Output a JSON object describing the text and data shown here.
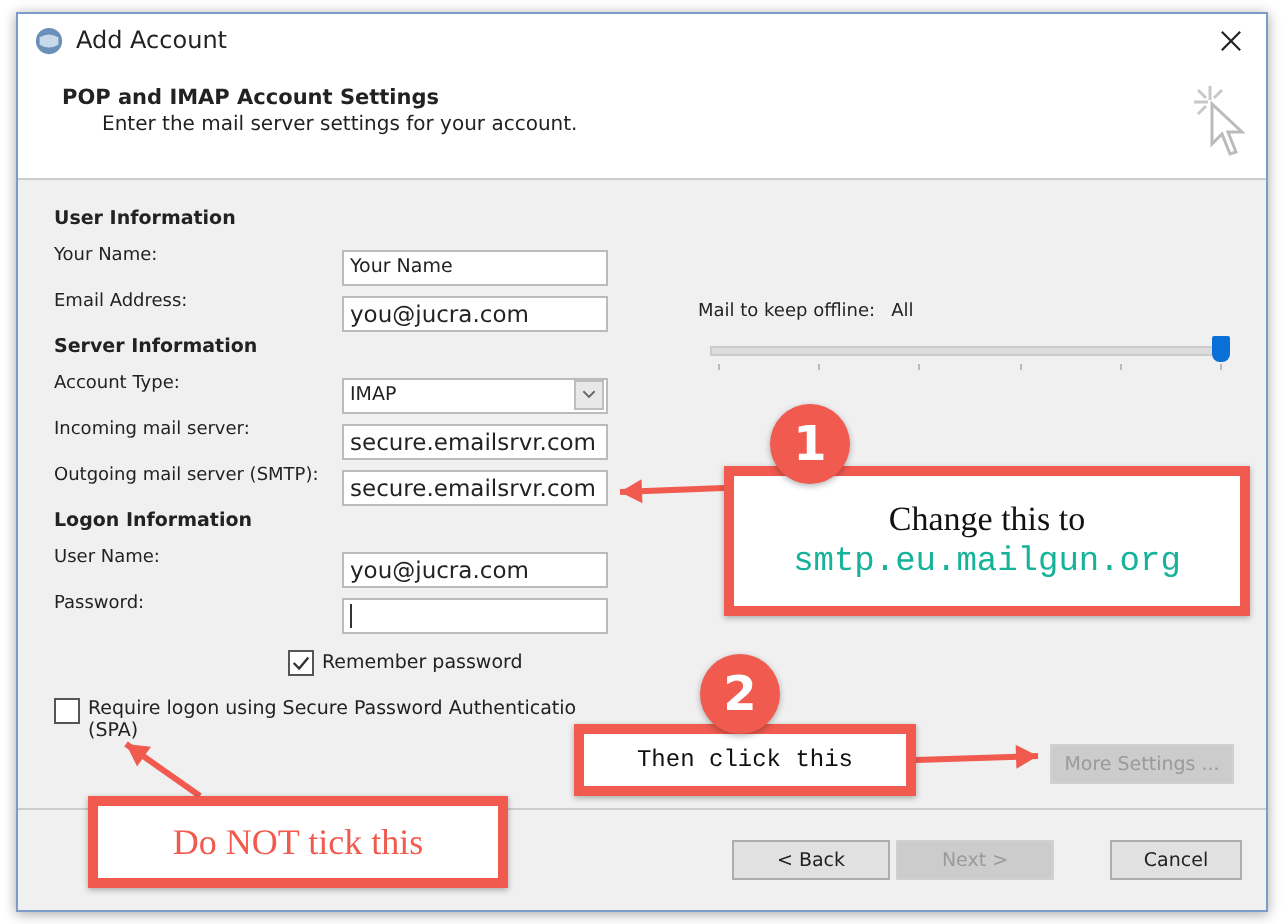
{
  "window": {
    "title": "Add Account"
  },
  "header": {
    "title": "POP and IMAP Account Settings",
    "subtitle": "Enter the mail server settings for your account."
  },
  "sections": [
    {
      "heading": "User Information",
      "fields": [
        {
          "label": "Your Name:",
          "kind": "text",
          "value": "Your Name"
        },
        {
          "label": "Email Address:",
          "kind": "text",
          "value": "you@jucra.com"
        }
      ]
    },
    {
      "heading": "Server Information",
      "fields": [
        {
          "label": "Account Type:",
          "kind": "select",
          "value": "IMAP"
        },
        {
          "label": "Incoming mail server:",
          "kind": "text",
          "value": "secure.emailsrvr.com"
        },
        {
          "label": "Outgoing mail server (SMTP):",
          "kind": "text",
          "value": "secure.emailsrvr.com"
        }
      ]
    },
    {
      "heading": "Logon Information",
      "fields": [
        {
          "label": "User Name:",
          "kind": "text",
          "value": "you@jucra.com"
        },
        {
          "label": "Password:",
          "kind": "password"
        }
      ]
    }
  ],
  "remember_password": {
    "label": "Remember password",
    "checked": true
  },
  "spa": {
    "label": "Require logon using Secure Password Authenticatio",
    "label_2": "(SPA)",
    "checked": false
  },
  "offline": {
    "label": "Mail to keep offline:",
    "value": "All",
    "level": 1
  },
  "more_settings": {
    "label": "More Settings ...",
    "disabled": true
  },
  "buttons": [
    {
      "label": "< Back",
      "disabled": false
    },
    {
      "label": "Next >",
      "disabled": true
    },
    {
      "label": "Cancel",
      "disabled": false
    }
  ],
  "callouts": [
    {
      "number": "1",
      "lines": [
        {
          "kind": "serif",
          "text": "Change this to"
        },
        {
          "kind": "mono",
          "text": "smtp.eu.mailgun.org"
        }
      ]
    },
    {
      "number": "2",
      "lines": [
        {
          "kind": "mono",
          "text": "Then click this"
        }
      ]
    },
    {
      "lines": [
        {
          "kind": "serif",
          "text": "Do NOT tick this"
        }
      ]
    }
  ]
}
